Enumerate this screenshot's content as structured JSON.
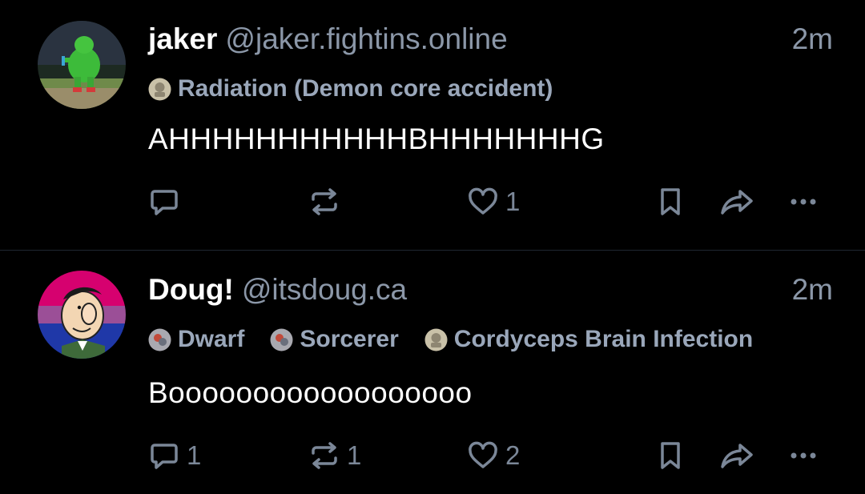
{
  "posts": [
    {
      "display_name": "jaker",
      "handle": "@jaker.fightins.online",
      "time": "2m",
      "labels": [
        {
          "text": "Radiation (Demon core accident)",
          "icon": "label-badge-icon"
        }
      ],
      "text": "AHHHHHHHHHHHBHHHHHHHG",
      "avatar": "mascot-avatar",
      "actions": {
        "replies": "",
        "reposts": "",
        "likes": "1"
      }
    },
    {
      "display_name": "Doug!",
      "handle": "@itsdoug.ca",
      "time": "2m",
      "labels": [
        {
          "text": "Dwarf",
          "icon": "label-badge-icon"
        },
        {
          "text": "Sorcerer",
          "icon": "label-badge-icon"
        },
        {
          "text": "Cordyceps Brain Infection",
          "icon": "label-badge-icon"
        }
      ],
      "text": "Boooooooooooooooooo",
      "avatar": "cartoon-avatar",
      "actions": {
        "replies": "1",
        "reposts": "1",
        "likes": "2"
      }
    }
  ],
  "colors": {
    "background": "#000000",
    "muted": "#8b97a8",
    "icon": "#7b8798",
    "divider": "#1f2731"
  },
  "icons": [
    "reply-icon",
    "repost-icon",
    "like-icon",
    "bookmark-icon",
    "share-icon",
    "more-icon"
  ]
}
